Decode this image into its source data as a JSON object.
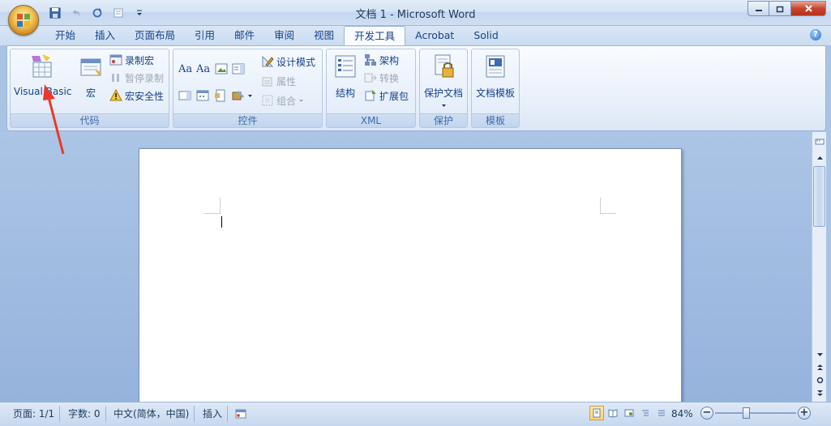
{
  "window": {
    "title": "文档 1 - Microsoft Word"
  },
  "tabs": [
    {
      "label": "开始"
    },
    {
      "label": "插入"
    },
    {
      "label": "页面布局"
    },
    {
      "label": "引用"
    },
    {
      "label": "邮件"
    },
    {
      "label": "审阅"
    },
    {
      "label": "视图"
    },
    {
      "label": "开发工具",
      "active": true
    },
    {
      "label": "Acrobat"
    },
    {
      "label": "Solid"
    }
  ],
  "ribbon": {
    "code": {
      "label": "代码",
      "visual_basic": "Visual Basic",
      "macro": "宏",
      "record_macro": "录制宏",
      "pause_recording": "暂停录制",
      "macro_security": "宏安全性"
    },
    "controls": {
      "label": "控件",
      "aa1": "Aa",
      "aa2": "Aa",
      "design_mode": "设计模式",
      "properties": "属性",
      "group": "组合"
    },
    "xml": {
      "label": "XML",
      "structure": "结构",
      "schema": "架构",
      "transform": "转换",
      "expansion_pack": "扩展包"
    },
    "protect": {
      "label": "保护",
      "protect_document": "保护文档"
    },
    "templates": {
      "label": "模板",
      "document_template": "文档模板"
    }
  },
  "status": {
    "page": "页面: 1/1",
    "words": "字数: 0",
    "language": "中文(简体，中国)",
    "insert_mode": "插入",
    "zoom": "84%",
    "zoom_minus": "−",
    "zoom_plus": "+"
  },
  "colors": {
    "accent": "#15428b",
    "annotation_arrow": "#e8392b"
  }
}
